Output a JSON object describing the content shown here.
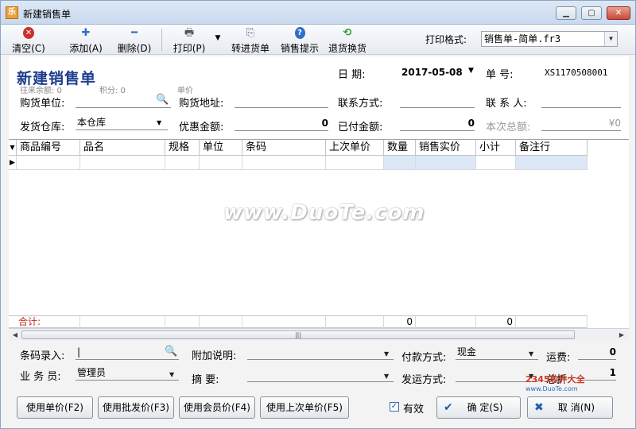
{
  "window": {
    "title": "新建销售单",
    "app_icon": "app-icon"
  },
  "toolbar": {
    "items": [
      {
        "label": "清空(C)",
        "icon": "clear-icon"
      },
      {
        "label": "添加(A)",
        "icon": "add-icon"
      },
      {
        "label": "删除(D)",
        "icon": "delete-icon"
      },
      {
        "label": "打印(P)",
        "icon": "print-icon"
      },
      {
        "label": "转进货单",
        "icon": "convert-icon"
      },
      {
        "label": "销售提示",
        "icon": "help-icon"
      },
      {
        "label": "退货换货",
        "icon": "return-icon"
      }
    ],
    "print_format_label": "打印格式:",
    "print_format_value": "销售单-简单.fr3"
  },
  "header": {
    "doc_title": "新建销售单",
    "hint_balance": "往来余额: 0",
    "hint_points": "积分: 0",
    "hint_unit_price": "单价",
    "date_label": "日    期:",
    "date_value": "2017-05-08",
    "number_label": "单    号:",
    "number_value": "XS1170508001",
    "buyer_label": "购货单位:",
    "address_label": "购货地址:",
    "contact_method_label": "联系方式:",
    "contact_person_label": "联 系 人:",
    "warehouse_label": "发货仓库:",
    "warehouse_value": "本仓库",
    "discount_label": "优惠金额:",
    "discount_value": "0",
    "paid_label": "已付金额:",
    "paid_value": "0",
    "total_label": "本次总额:",
    "total_value": "¥0"
  },
  "grid": {
    "columns": [
      "商品编号",
      "品名",
      "规格",
      "单位",
      "条码",
      "上次单价",
      "数量",
      "销售实价",
      "小计",
      "备注行"
    ],
    "totals_label": "合计:",
    "totals_qty": "0",
    "totals_subtotal": "0"
  },
  "footer": {
    "barcode_label": "条码录入:",
    "barcode_value": "|",
    "note_label": "附加说明:",
    "payment_label": "付款方式:",
    "payment_value": "现金",
    "freight_label": "运费:",
    "freight_value": "0",
    "salesman_label": "业 务 员:",
    "salesman_value": "管理员",
    "summary_label": "摘    要:",
    "shipping_label": "发运方式:",
    "discount_rate_label": "总折:",
    "discount_rate_value": "1"
  },
  "buttons": {
    "unit_price": "使用单价(F2)",
    "wholesale_price": "使用批发价(F3)",
    "member_price": "使用会员价(F4)",
    "last_price": "使用上次单价(F5)",
    "valid_label": "有效",
    "valid_checked": true,
    "ok": "确  定(S)",
    "cancel": "取  消(N)"
  },
  "watermark": "www.DuoTe.com",
  "logo": {
    "text": "2345软件大全",
    "sub": "www.DuoTe.com"
  }
}
